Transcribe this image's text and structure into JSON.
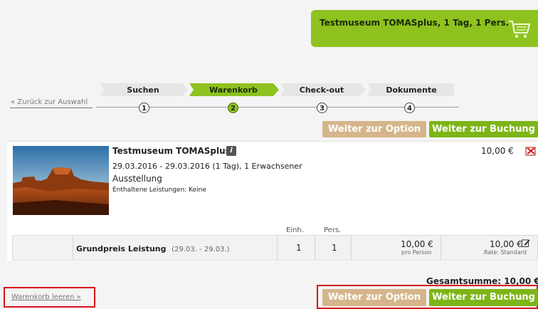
{
  "cart": {
    "label": "Testmuseum TOMASplus, 1 Tag, 1 Pers.",
    "icon": "shopping-cart-icon"
  },
  "nav": {
    "back_link": "« Zurück zur Auswahl",
    "steps": [
      {
        "label": "Suchen",
        "number": "1",
        "active": false
      },
      {
        "label": "Warenkorb",
        "number": "2",
        "active": true
      },
      {
        "label": "Check-out",
        "number": "3",
        "active": false
      },
      {
        "label": "Dokumente",
        "number": "4",
        "active": false
      }
    ]
  },
  "actions": {
    "option_label": "Weiter zur Option",
    "booking_label": "Weiter zur Buchung"
  },
  "item": {
    "title": "Testmuseum TOMASplus",
    "info_icon": "i",
    "dates": "29.03.2016 - 29.03.2016 (1 Tag), 1 Erwachsener",
    "type": "Ausstellung",
    "included": "Enthaltene Leistungen: Keine",
    "price": "10,00 €",
    "image_desc": "desert-mesa-photo"
  },
  "table": {
    "col_units": "Einh.",
    "col_pers": "Pers.",
    "row": {
      "name": "Grundpreis Leistung",
      "range": "(29.03. - 29.03.)",
      "units": "1",
      "persons": "1",
      "price": "10,00 €",
      "price_note": "pro Person",
      "total": "10,00 €",
      "rate": "Rate: Standard"
    }
  },
  "summary": {
    "total_label": "Gesamtsumme:  10,00 €"
  },
  "footer": {
    "clear_link": "Warenkorb leeren »"
  },
  "colors": {
    "brand_green": "#8dc21f",
    "button_green": "#7cb516",
    "button_tan": "#d5b58a",
    "highlight_red": "#d8141b"
  }
}
